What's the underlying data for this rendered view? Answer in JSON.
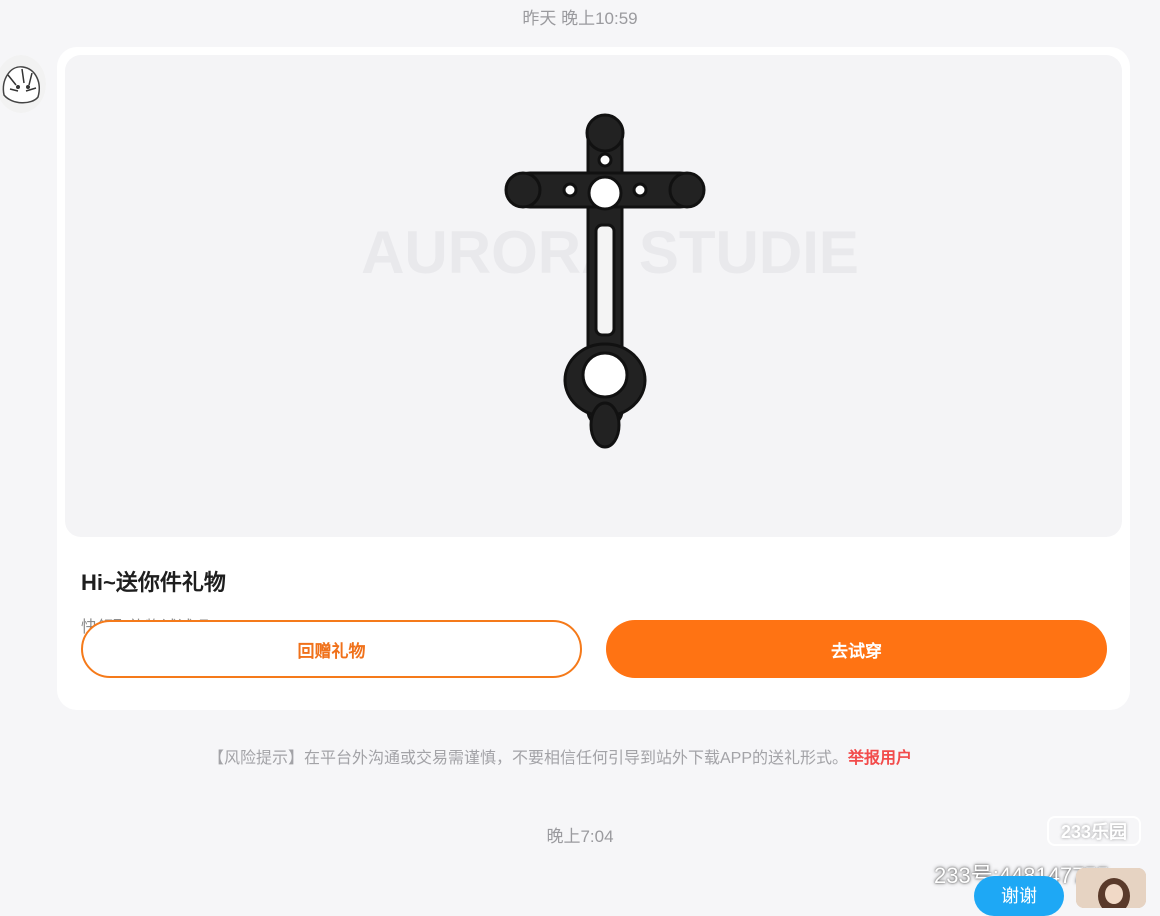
{
  "chat": {
    "timestamp_top": "昨天 晚上10:59",
    "timestamp_bottom": "晚上7:04"
  },
  "gift_card": {
    "image_watermark_text": "AURORA STUDIE",
    "title": "Hi~送你件礼物",
    "subtitle": "快领取礼物试试吧~",
    "return_gift_label": "回赠礼物",
    "try_on_label": "去试穿"
  },
  "risk_notice": {
    "text": "【风险提示】在平台外沟通或交易需谨慎，不要相信任何引导到站外下载APP的送礼形式。",
    "report_link": "举报用户"
  },
  "watermark": {
    "logo_text": "233乐园",
    "account_id": "233号:448147755"
  },
  "thanks_button": {
    "label": "谢谢"
  },
  "colors": {
    "accent_orange": "#ff7313",
    "report_red": "#f24b4b",
    "background": "#f6f6f8"
  }
}
